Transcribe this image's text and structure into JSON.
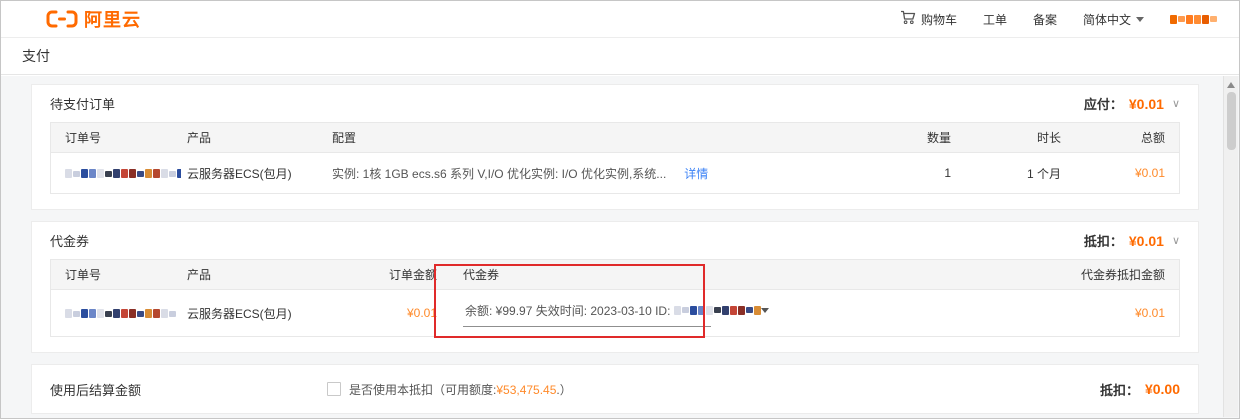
{
  "topbar": {
    "logo_text": "阿里云",
    "nav": [
      {
        "label": "购物车"
      },
      {
        "label": "工单"
      },
      {
        "label": "备案"
      },
      {
        "label": "简体中文"
      }
    ]
  },
  "page_title": "支付",
  "icons": {
    "collapse_chevron": "∨"
  },
  "pending_orders": {
    "title": "待支付订单",
    "payable_label": "应付：",
    "payable_amount": "¥0.01",
    "table": {
      "headers": [
        "订单号",
        "产品",
        "配置",
        "数量",
        "时长",
        "总额"
      ],
      "row": {
        "product": "云服务器ECS(包月)",
        "config": "实例: 1核 1GB ecs.s6 系列 V,I/O 优化实例: I/O 优化实例,系统...",
        "detail_link": "详情",
        "quantity": "1",
        "duration": "1 个月",
        "total": "¥0.01"
      }
    }
  },
  "voucher": {
    "title": "代金券",
    "deduct_label": "抵扣：",
    "deduct_amount": "¥0.01",
    "table": {
      "headers": [
        "订单号",
        "产品",
        "订单金额",
        "代金券",
        "代金券抵扣金额"
      ],
      "row": {
        "product": "云服务器ECS(包月)",
        "order_amount": "¥0.01",
        "voucher_option": "余额: ¥99.97 失效时间: 2023-03-10 ID:",
        "voucher_deduct": "¥0.01"
      }
    }
  },
  "settlement": {
    "title": "使用后结算金额",
    "checkbox_label_prefix": "是否使用本抵扣（可用额度:",
    "available_amount": "¥53,475.45",
    "checkbox_label_suffix": ".）",
    "deduct_label": "抵扣：",
    "deduct_amount": "¥0.00"
  },
  "colors": {
    "brand_orange": "#ff6a00",
    "amount_orange": "#ff8a2a",
    "link_blue": "#3b82f6",
    "highlight_red": "#e02a2a"
  }
}
